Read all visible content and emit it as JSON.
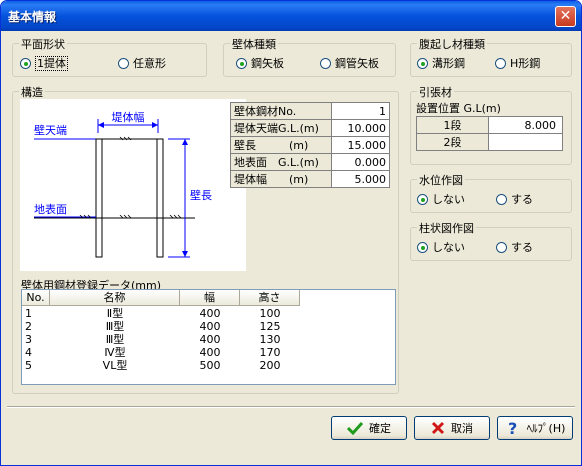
{
  "window": {
    "title": "基本情報",
    "close_glyph": "✕"
  },
  "plane_shape": {
    "label": "平面形状",
    "options": [
      {
        "label": "1提体",
        "selected": true
      },
      {
        "label": "任意形",
        "selected": false
      }
    ]
  },
  "wall_type": {
    "label": "壁体種類",
    "options": [
      {
        "label": "鋼矢板",
        "selected": true
      },
      {
        "label": "鋼管矢板",
        "selected": false
      }
    ]
  },
  "wale_type": {
    "label": "腹起し材種類",
    "options": [
      {
        "label": "溝形鋼",
        "selected": true
      },
      {
        "label": "H形鋼",
        "selected": false
      }
    ]
  },
  "structure": {
    "label": "構造",
    "diagram": {
      "embank_width": "堤体幅",
      "wall_top": "壁天端",
      "ground": "地表面",
      "wall_length": "壁長"
    },
    "params": [
      {
        "label": "壁体鋼材No.",
        "value": "1"
      },
      {
        "label": "堤体天端G.L.(m)",
        "value": "10.000"
      },
      {
        "label": "壁長　　　(m)",
        "value": "15.000"
      },
      {
        "label": "地表面　G.L.(m)",
        "value": "0.000"
      },
      {
        "label": "堤体幅　　(m)",
        "value": "5.000"
      }
    ],
    "steel_list": {
      "label": "壁体用鋼材登録データ(mm)",
      "columns": [
        "No.",
        "名称",
        "幅",
        "高さ"
      ],
      "rows": [
        [
          "1",
          "Ⅱ型",
          "400",
          "100"
        ],
        [
          "2",
          "Ⅲ型",
          "400",
          "125"
        ],
        [
          "3",
          "Ⅲ型",
          "400",
          "130"
        ],
        [
          "4",
          "Ⅳ型",
          "400",
          "170"
        ],
        [
          "5",
          "VL型",
          "500",
          "200"
        ]
      ]
    }
  },
  "tie": {
    "label": "引張材",
    "sublabel": "設置位置 G.L(m)",
    "rows": [
      {
        "label": "1段",
        "value": "8.000"
      },
      {
        "label": "2段",
        "value": ""
      }
    ]
  },
  "water_diagram": {
    "label": "水位作図",
    "options": [
      {
        "label": "しない",
        "selected": true
      },
      {
        "label": "する",
        "selected": false
      }
    ]
  },
  "column_diagram": {
    "label": "柱状図作図",
    "options": [
      {
        "label": "しない",
        "selected": true
      },
      {
        "label": "する",
        "selected": false
      }
    ]
  },
  "buttons": {
    "ok": "確定",
    "cancel": "取消",
    "help": "ﾍﾙﾌﾟ(H)"
  },
  "colors": {
    "accent_blue": "#0000ff",
    "ok_green": "#1f9c1f",
    "cancel_red": "#d01818",
    "help_blue": "#1a4fb8"
  }
}
